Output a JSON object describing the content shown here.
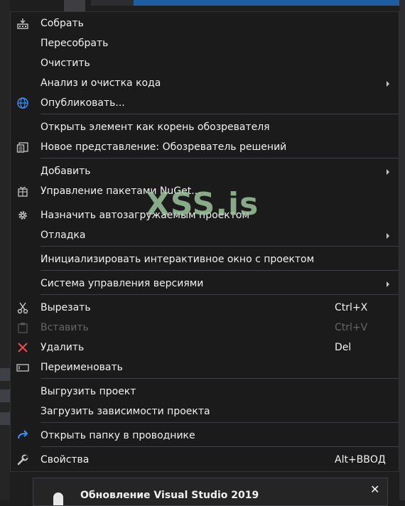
{
  "menu": {
    "items": [
      {
        "label": "Собрать",
        "icon": "build-icon"
      },
      {
        "label": "Пересобрать"
      },
      {
        "label": "Очистить"
      },
      {
        "label": "Анализ и очистка кода",
        "submenu": true
      },
      {
        "label": "Опубликовать...",
        "icon": "globe-icon"
      },
      {
        "label": "Открыть элемент как корень обозревателя"
      },
      {
        "label": "Новое представление: Обозреватель решений",
        "icon": "new-view-icon"
      },
      {
        "label": "Добавить",
        "submenu": true
      },
      {
        "label": "Управление пакетами NuGet...",
        "icon": "nuget-icon"
      },
      {
        "label": "Назначить автозагружаемым проектом",
        "icon": "gear-icon"
      },
      {
        "label": "Отладка",
        "submenu": true
      },
      {
        "label": "Инициализировать интерактивное окно с проектом"
      },
      {
        "label": "Система управления версиями",
        "submenu": true
      },
      {
        "label": "Вырезать",
        "shortcut": "Ctrl+X",
        "icon": "scissors-icon"
      },
      {
        "label": "Вставить",
        "shortcut": "Ctrl+V",
        "icon": "paste-icon",
        "disabled": true
      },
      {
        "label": "Удалить",
        "shortcut": "Del",
        "icon": "delete-icon"
      },
      {
        "label": "Переименовать",
        "icon": "rename-icon"
      },
      {
        "label": "Выгрузить проект"
      },
      {
        "label": "Загрузить зависимости проекта"
      },
      {
        "label": "Открыть папку в проводнике",
        "icon": "refresh-arrow-icon"
      },
      {
        "label": "Свойства",
        "shortcut": "Alt+ВВОД",
        "icon": "wrench-icon"
      }
    ]
  },
  "watermark": "XSS.is",
  "toast": {
    "title": "Обновление Visual Studio 2019",
    "close": "✕"
  },
  "colors": {
    "menu_bg": "#1b1b1c",
    "separator": "#3f3f46",
    "disabled_text": "#656565",
    "accent": "#1c5ea0"
  }
}
